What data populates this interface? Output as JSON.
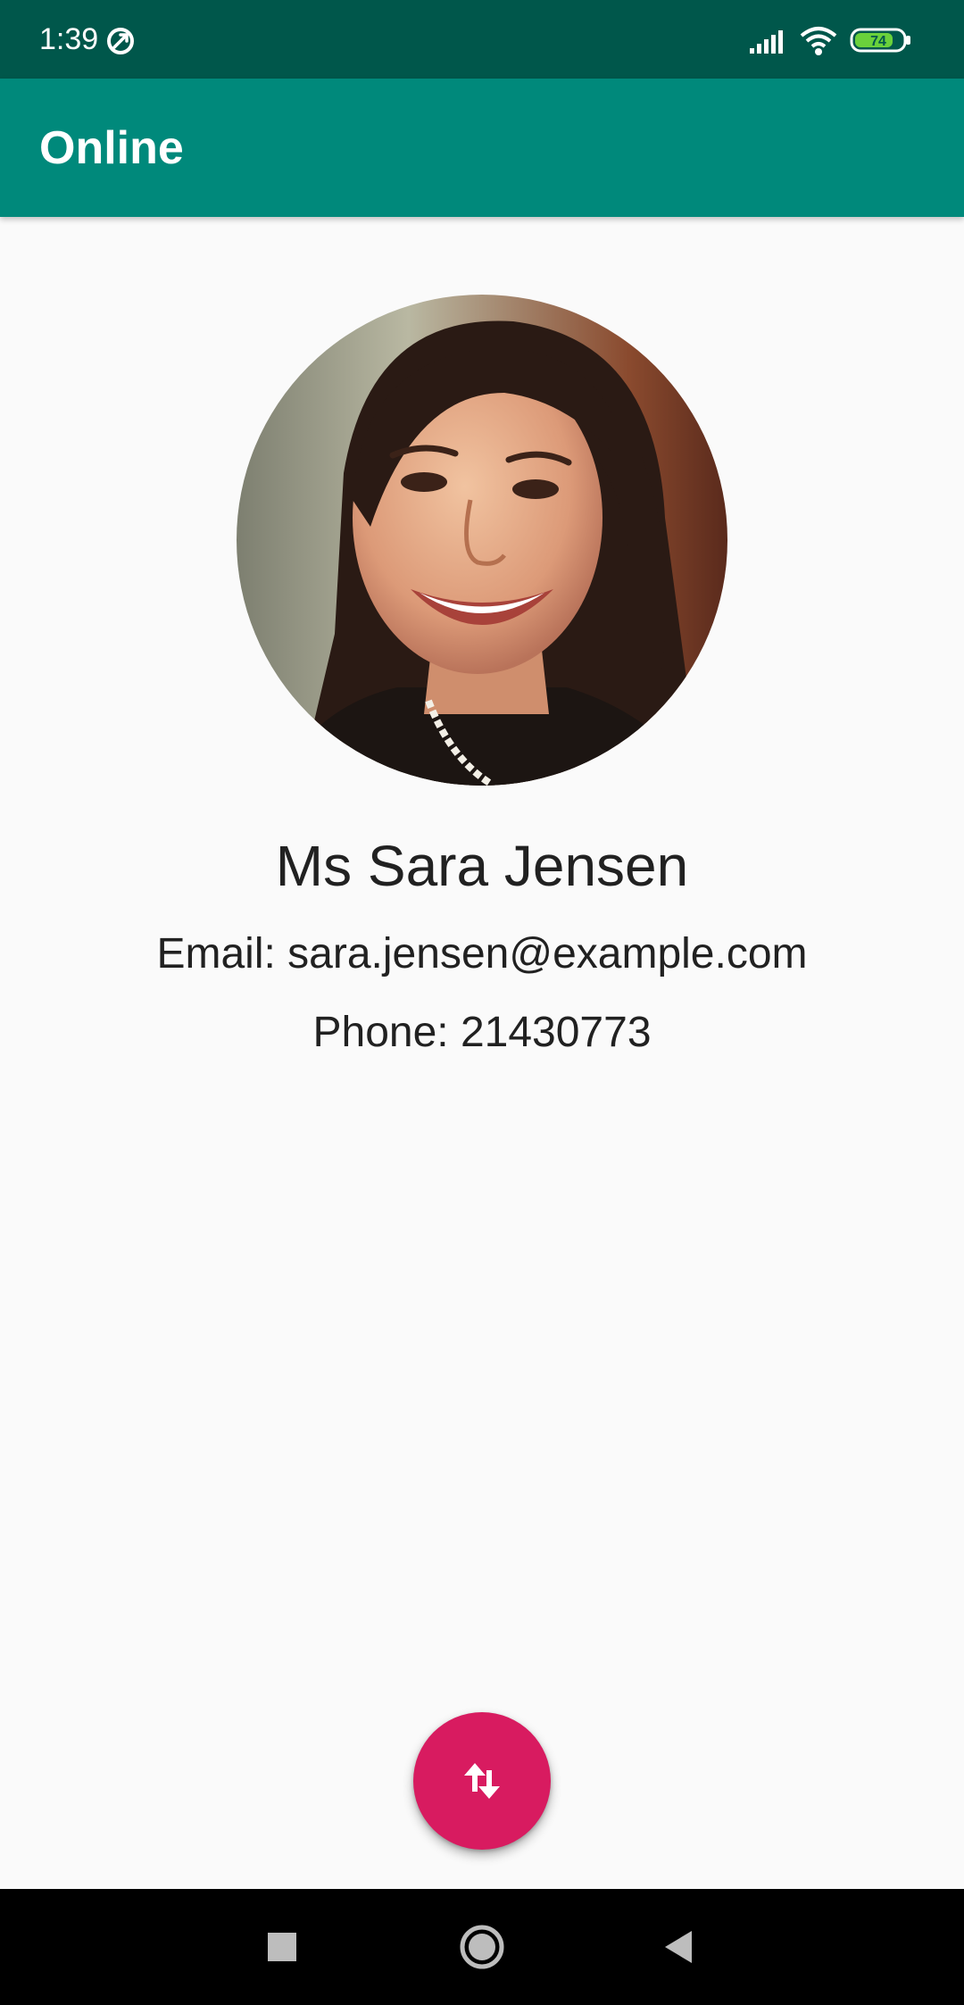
{
  "status_bar": {
    "time": "1:39",
    "battery_level": "74",
    "icons": [
      "sync-icon",
      "signal-icon",
      "wifi-icon",
      "battery-icon"
    ],
    "background_color": "#00574b"
  },
  "app_bar": {
    "title": "Online",
    "background_color": "#00897b"
  },
  "profile": {
    "name": "Ms Sara Jensen",
    "email": "Email: sara.jensen@example.com",
    "phone": "Phone: 21430773"
  },
  "fab": {
    "icon": "swap-vertical-icon",
    "color": "#d81b60"
  },
  "nav_bar": {
    "icons": [
      "recents-icon",
      "home-icon",
      "back-icon"
    ]
  }
}
